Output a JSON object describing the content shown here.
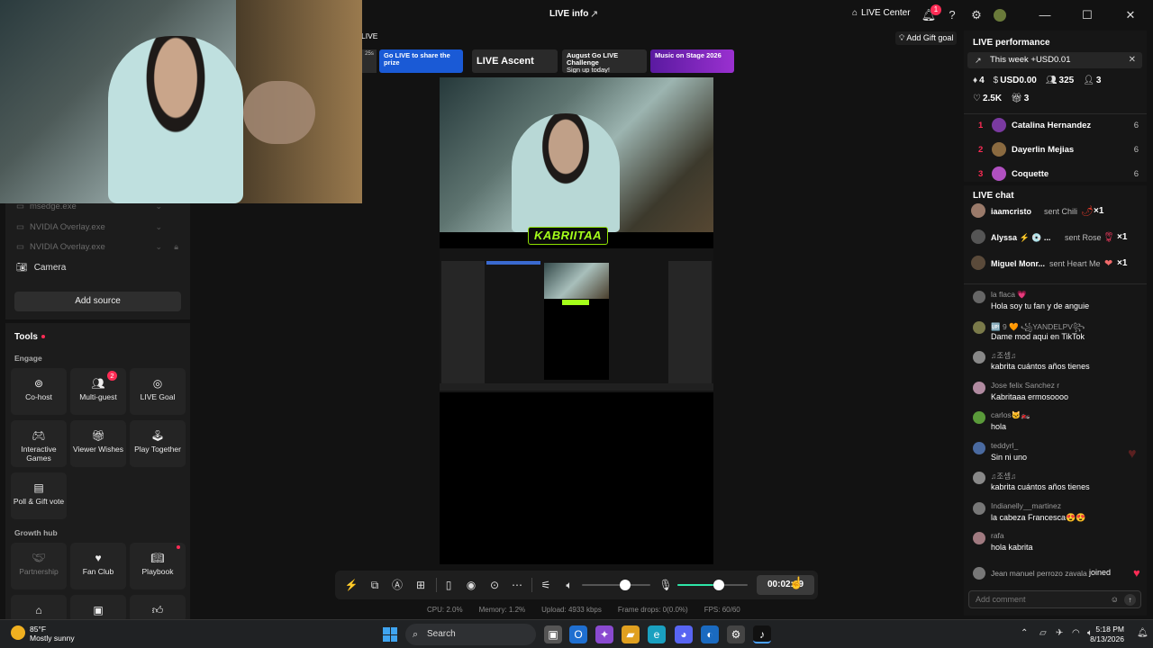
{
  "header": {
    "title": "LIVE info",
    "live_center": "LIVE Center",
    "notif_count": "1"
  },
  "sources": {
    "items": [
      {
        "label": "msedge.exe"
      },
      {
        "label": "NVIDIA Overlay.exe"
      },
      {
        "label": "NVIDIA Overlay.exe"
      }
    ],
    "camera": "Camera",
    "add_source": "Add source"
  },
  "tools": {
    "title": "Tools",
    "engage_label": "Engage",
    "engage": [
      {
        "label": "Co-host",
        "icon": "link-icon"
      },
      {
        "label": "Multi-guest",
        "icon": "people-icon",
        "badge": "2"
      },
      {
        "label": "LIVE Goal",
        "icon": "target-icon"
      },
      {
        "label": "Interactive Games",
        "icon": "gamepad-icon"
      },
      {
        "label": "Viewer Wishes",
        "icon": "gift-icon"
      },
      {
        "label": "Play Together",
        "icon": "joystick-icon"
      },
      {
        "label": "Poll & Gift vote",
        "icon": "poll-icon"
      }
    ],
    "growth_label": "Growth hub",
    "growth": [
      {
        "label": "Partnership",
        "icon": "handshake-icon"
      },
      {
        "label": "Fan Club",
        "icon": "heart-icon"
      },
      {
        "label": "Playbook",
        "icon": "book-icon"
      }
    ]
  },
  "stream": {
    "live_label": "LIVE",
    "timer_chip": "25s",
    "banners": [
      {
        "text": "Go LIVE to share the prize"
      },
      {
        "text": "LIVE Ascent"
      },
      {
        "text": "August Go LIVE Challenge",
        "sub": "Sign up today!"
      },
      {
        "text": "Music on Stage 2026"
      }
    ],
    "overlay_name": "KABRIITAA",
    "timer": "00:02:39"
  },
  "stats": {
    "cpu": "CPU:  2.0%",
    "memory": "Memory:  1.2%",
    "upload": "Upload:  4933 kbps",
    "drops": "Frame drops:  0(0.0%)",
    "fps": "FPS:  60/60"
  },
  "performance": {
    "add_gift": "Add Gift goal",
    "title": "LIVE performance",
    "week": "This week +USD0.01",
    "diamonds": "4",
    "usd": "USD0.00",
    "viewers": "325",
    "new_followers": "3",
    "likes": "2.5K",
    "gifters": "3",
    "ranking": [
      {
        "rank": "1",
        "name": "Catalina Hernandez",
        "count": "6",
        "color": "#7a3aa0"
      },
      {
        "rank": "2",
        "name": "Dayerlin Mejias",
        "count": "6",
        "color": "#8a6a40"
      },
      {
        "rank": "3",
        "name": "Coquette",
        "count": "6",
        "color": "#b050c0"
      }
    ]
  },
  "chat": {
    "title": "LIVE chat",
    "gifts": [
      {
        "user": "iaamcristo",
        "text": "sent Chili",
        "icon": "chili-icon",
        "count": "×1"
      },
      {
        "user": "Alyssa ⚡ 💿 ...",
        "text": "sent Rose",
        "icon": "rose-icon",
        "count": "×1"
      },
      {
        "user": "Miguel Monr...",
        "text": "sent Heart Me",
        "icon": "heart-me-icon",
        "count": "×1"
      }
    ],
    "messages": [
      {
        "user": "la flaca 💗",
        "text": "Hola soy tu fan y de anguie",
        "color": "#666"
      },
      {
        "user": "🆙 9 🧡 ꧁YANDELPV꧂",
        "text": "Dame mod aqui en TikTok",
        "color": "#7a7a4a"
      },
      {
        "user": "♫조셈♫",
        "text": "kabrita cuántos años tienes",
        "color": "#888"
      },
      {
        "user": "Jose felix Sanchez r",
        "text": "Kabritaaa ermosoooo",
        "color": "#b08aa0"
      },
      {
        "user": "carlos🐱‍🏍",
        "text": "hola",
        "color": "#5a9a3a"
      },
      {
        "user": "teddyrl_",
        "text": "Sin ni uno",
        "color": "#4a6aa0"
      },
      {
        "user": "♫조셈♫",
        "text": "kabrita cuántos años tienes",
        "color": "#888"
      },
      {
        "user": "Indianelly__martinez",
        "text": "la cabeza Francesca😍😍",
        "color": "#777"
      },
      {
        "user": "rafa",
        "text": "hola kabrita",
        "color": "#a07a80"
      }
    ],
    "joined_user": "Jean manuel perrozo zavala",
    "joined_text": "joined",
    "comment_placeholder": "Add comment"
  },
  "taskbar": {
    "temp": "85°F",
    "weather": "Mostly sunny",
    "search": "Search",
    "time": "5:18 PM",
    "date": "8/13/2026"
  }
}
